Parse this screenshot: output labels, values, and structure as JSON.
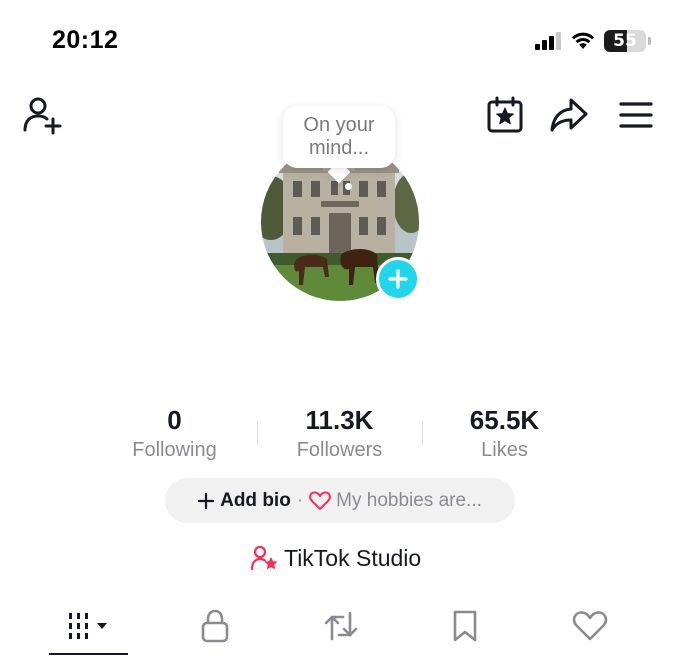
{
  "status_bar": {
    "time": "20:12",
    "battery_level": "55",
    "icons": [
      "signal-bars-icon",
      "wifi-icon",
      "battery-icon"
    ]
  },
  "header": {
    "icons": [
      "add-friend-icon",
      "calendar-star-icon",
      "share-arrow-icon",
      "hamburger-menu-icon"
    ]
  },
  "profile": {
    "bubble_text": "On your mind...",
    "avatar_icon": "profile-photo",
    "add_avatar_icon": "plus-icon"
  },
  "stats": [
    {
      "value": "0",
      "label": "Following"
    },
    {
      "value": "11.3K",
      "label": "Followers"
    },
    {
      "value": "65.5K",
      "label": "Likes"
    }
  ],
  "bio": {
    "add_label": "Add bio",
    "separator": "·",
    "hint": "My hobbies are..."
  },
  "studio": {
    "label": "TikTok Studio",
    "icon": "person-star-icon"
  },
  "tabs": [
    {
      "name": "videos-grid",
      "icon": "grid-bars-icon",
      "active": true
    },
    {
      "name": "private",
      "icon": "lock-icon"
    },
    {
      "name": "reposts",
      "icon": "repost-icon"
    },
    {
      "name": "favorites",
      "icon": "bookmark-icon"
    },
    {
      "name": "liked",
      "icon": "heart-icon"
    }
  ],
  "colors": {
    "accent_cyan": "#20d5ec",
    "accent_pink": "#fe2c55",
    "text_primary": "#161823",
    "text_secondary": "#8a8b91",
    "pill_bg": "#f1f1f2"
  }
}
